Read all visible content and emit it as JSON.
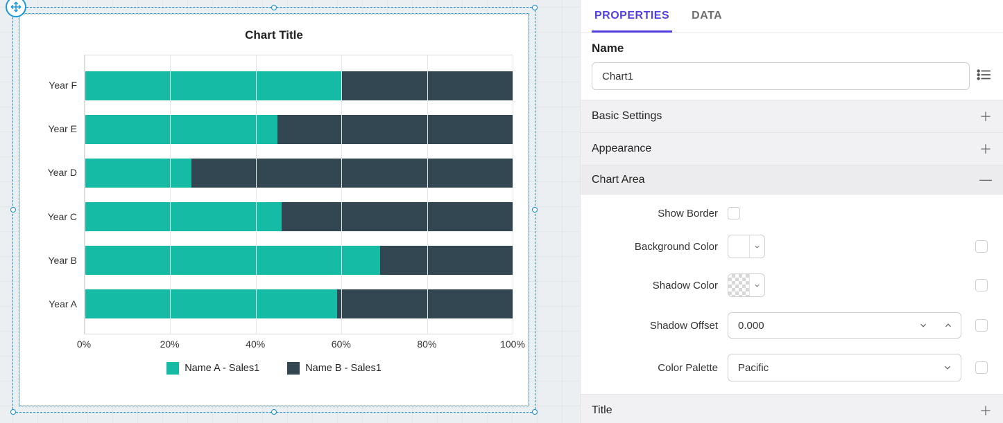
{
  "tabs": {
    "properties": "PROPERTIES",
    "data": "DATA"
  },
  "name_section": {
    "label": "Name",
    "value": "Chart1"
  },
  "accordions": {
    "basic": "Basic Settings",
    "appearance": "Appearance",
    "chart_area": "Chart Area",
    "title": "Title"
  },
  "chart_area": {
    "show_border": "Show Border",
    "background_color": "Background Color",
    "shadow_color": "Shadow Color",
    "shadow_offset_label": "Shadow Offset",
    "shadow_offset_value": "0.000",
    "color_palette_label": "Color Palette",
    "color_palette_value": "Pacific"
  },
  "chart_data": {
    "type": "bar",
    "orientation": "horizontal-stacked-100",
    "title": "Chart Title",
    "categories": [
      "Year F",
      "Year E",
      "Year D",
      "Year C",
      "Year B",
      "Year A"
    ],
    "series": [
      {
        "name": "Name A - Sales1",
        "color": "#16bba5",
        "values": [
          60,
          45,
          25,
          46,
          69,
          59
        ]
      },
      {
        "name": "Name B - Sales1",
        "color": "#324751",
        "values": [
          40,
          55,
          75,
          54,
          31,
          41
        ]
      }
    ],
    "x_ticks": [
      "0%",
      "20%",
      "40%",
      "60%",
      "80%",
      "100%"
    ],
    "xlim": [
      0,
      100
    ]
  }
}
